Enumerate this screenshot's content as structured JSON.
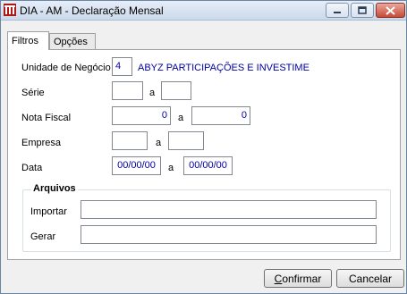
{
  "window": {
    "title": "DIA - AM - Declaração Mensal"
  },
  "tabs": [
    {
      "label": "Filtros",
      "active": true
    },
    {
      "label": "Opções",
      "active": false
    }
  ],
  "filters": {
    "unidade": {
      "label": "Unidade de Negócio",
      "code": "4",
      "name": "ABYZ PARTICIPAÇÕES E INVESTIME"
    },
    "serie": {
      "label": "Série",
      "from": "",
      "sep": "a",
      "to": ""
    },
    "nota_fiscal": {
      "label": "Nota Fiscal",
      "from": "0",
      "sep": "a",
      "to": "0"
    },
    "empresa": {
      "label": "Empresa",
      "from": "",
      "sep": "a",
      "to": ""
    },
    "data": {
      "label": "Data",
      "from": "00/00/00",
      "sep": "a",
      "to": "00/00/00"
    }
  },
  "arquivos": {
    "title": "Arquivos",
    "importar": {
      "label": "Importar",
      "value": ""
    },
    "gerar": {
      "label": "Gerar",
      "value": ""
    }
  },
  "buttons": {
    "confirmar": {
      "underline": "C",
      "rest": "onfirmar"
    },
    "cancelar": {
      "underline": "",
      "rest": "Cancelar"
    }
  },
  "colors": {
    "value_text": "#0000a0",
    "title_bg": "#cbd9ea",
    "close_button": "#c74a36"
  },
  "icons": [
    "app-icon",
    "minimize-icon",
    "maximize-icon",
    "close-icon"
  ]
}
